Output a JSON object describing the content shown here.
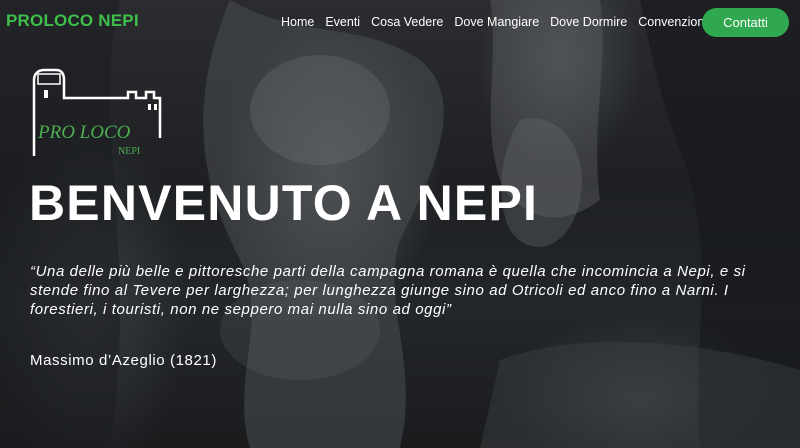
{
  "brand": {
    "text": "PROLOCO NEPI"
  },
  "nav": {
    "links": [
      "Home",
      "Eventi",
      "Cosa Vedere",
      "Dove Mangiare",
      "Dove Dormire",
      "Convenzioni"
    ],
    "contact_label": "Contatti"
  },
  "logo": {
    "text": "PRO LOCO NEPI"
  },
  "hero": {
    "title": "BENVENUTO A NEPI",
    "quote": "“Una delle più belle e pittoresche parti della campagna romana è quella che incomincia a Nepi, e si stende fino al Tevere per larghezza; per lunghezza giunge sino ad Otricoli ed anco fino a Narni. I forestieri, i touristi, non ne seppero mai nulla sino ad oggi”",
    "author": "Massimo d’Azeglio (1821)"
  },
  "colors": {
    "brand_green": "#3fbf4b",
    "button_green": "#2fa84f",
    "text": "#ffffff"
  }
}
